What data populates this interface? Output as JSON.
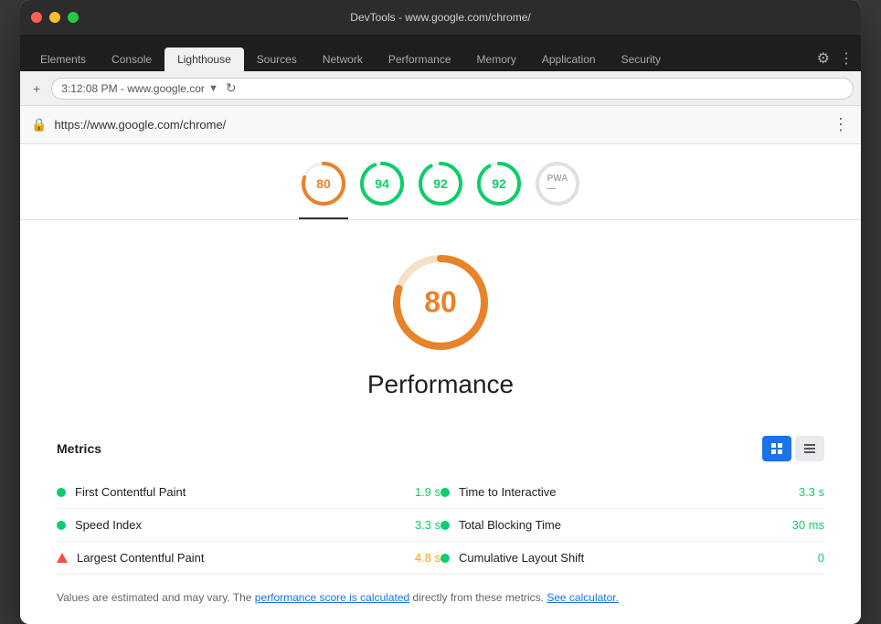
{
  "window": {
    "title": "DevTools - www.google.com/chrome/"
  },
  "traffic_lights": {
    "red": "red",
    "yellow": "yellow",
    "green": "green"
  },
  "tabs": [
    {
      "id": "elements",
      "label": "Elements",
      "active": false
    },
    {
      "id": "console",
      "label": "Console",
      "active": false
    },
    {
      "id": "lighthouse",
      "label": "Lighthouse",
      "active": true
    },
    {
      "id": "sources",
      "label": "Sources",
      "active": false
    },
    {
      "id": "network",
      "label": "Network",
      "active": false
    },
    {
      "id": "performance",
      "label": "Performance",
      "active": false
    },
    {
      "id": "memory",
      "label": "Memory",
      "active": false
    },
    {
      "id": "application",
      "label": "Application",
      "active": false
    },
    {
      "id": "security",
      "label": "Security",
      "active": false
    }
  ],
  "toolbar": {
    "address": "3:12:08 PM - www.google.cor",
    "settings_icon": "⚙",
    "more_icon": "⋮"
  },
  "url_bar": {
    "url": "https://www.google.com/chrome/",
    "more_icon": "⋮"
  },
  "score_tabs": [
    {
      "id": "perf",
      "score": "80",
      "color": "#e8832a",
      "bg": "#fff7f0",
      "active": true,
      "circumference": 150.8,
      "dash": 120.6
    },
    {
      "id": "acc",
      "score": "94",
      "color": "#0cce6b",
      "bg": "#f0fdf5",
      "active": false,
      "circumference": 150.8,
      "dash": 141.8
    },
    {
      "id": "bp",
      "score": "92",
      "color": "#0cce6b",
      "bg": "#f0fdf5",
      "active": false,
      "circumference": 150.8,
      "dash": 138.7
    },
    {
      "id": "seo",
      "score": "92",
      "color": "#0cce6b",
      "bg": "#f0fdf5",
      "active": false,
      "circumference": 150.8,
      "dash": 138.7
    },
    {
      "id": "pwa",
      "score": "PWA",
      "color": "#999",
      "bg": "#f0f0f0",
      "active": false,
      "circumference": 150.8,
      "dash": 0
    }
  ],
  "big_score": {
    "value": "80",
    "label": "Performance",
    "color": "#e8832a",
    "circumference": 301.6,
    "dash": 241.3
  },
  "metrics": {
    "label": "Metrics",
    "view_grid_label": "⊞",
    "view_list_label": "≡",
    "items_left": [
      {
        "name": "First Contentful Paint",
        "value": "1.9 s",
        "indicator": "dot-green"
      },
      {
        "name": "Speed Index",
        "value": "3.3 s",
        "indicator": "dot-green"
      },
      {
        "name": "Largest Contentful Paint",
        "value": "4.8 s",
        "indicator": "triangle-red"
      }
    ],
    "items_right": [
      {
        "name": "Time to Interactive",
        "value": "3.3 s",
        "indicator": "dot-green"
      },
      {
        "name": "Total Blocking Time",
        "value": "30 ms",
        "indicator": "dot-green"
      },
      {
        "name": "Cumulative Layout Shift",
        "value": "0",
        "indicator": "dot-green"
      }
    ]
  },
  "footer": {
    "text_before": "Values are estimated and may vary. The ",
    "link1": "performance score is calculated",
    "text_middle": " directly from these metrics. ",
    "link2": "See calculator."
  }
}
